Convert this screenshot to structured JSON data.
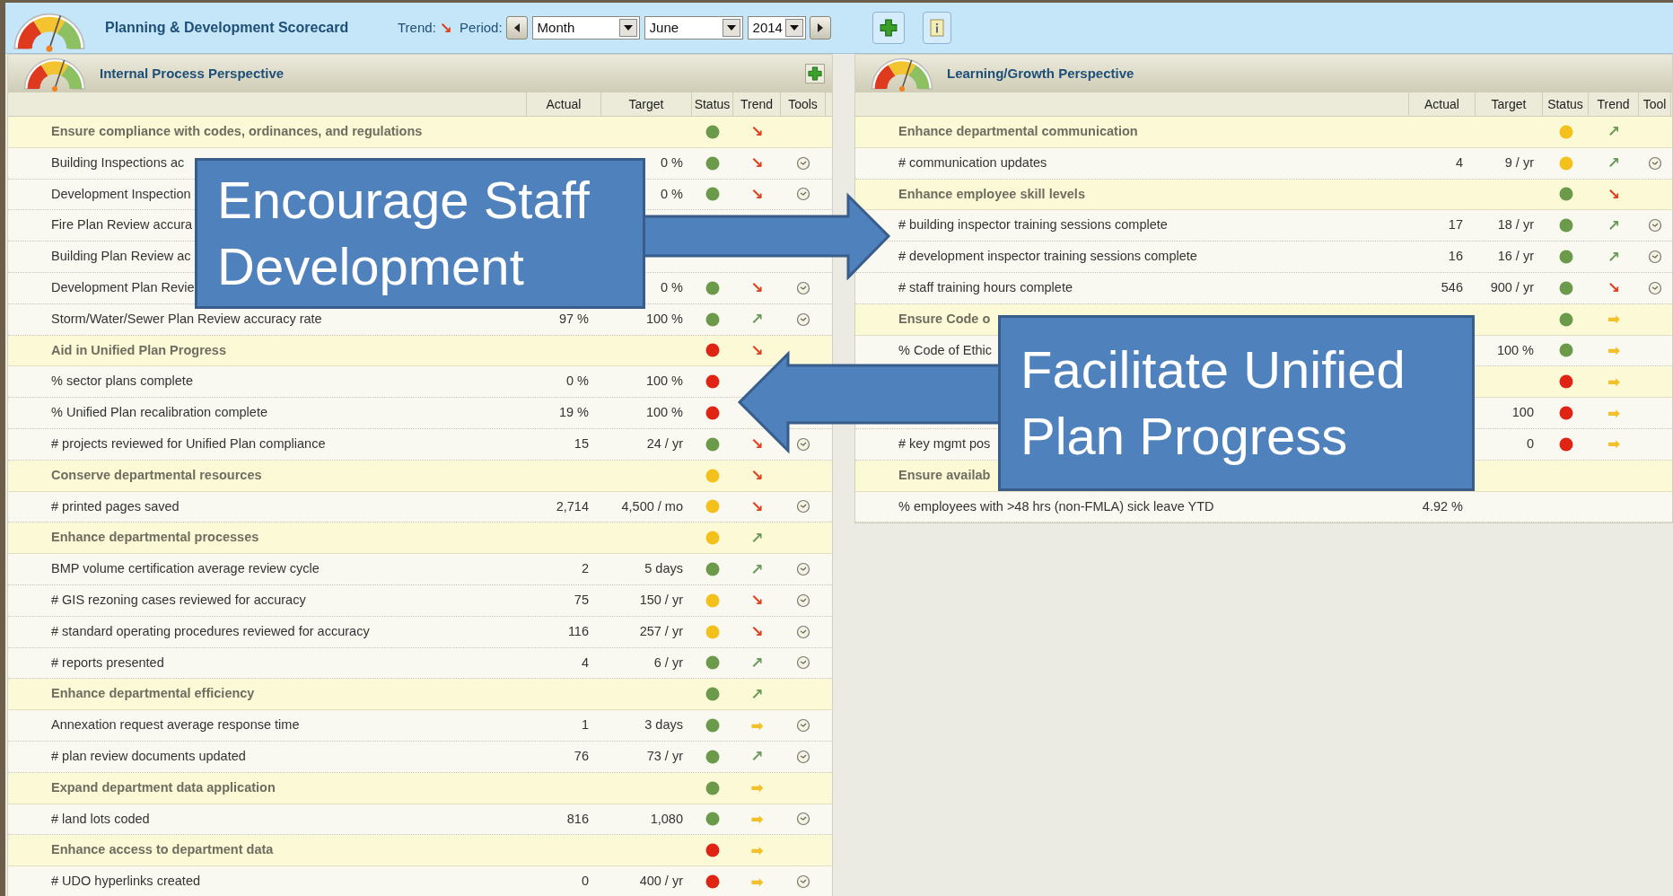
{
  "app": {
    "title": "Planning & Development Scorecard",
    "trend_label": "Trend:",
    "trend": {
      "symbol": "↘",
      "color": "#e0401e"
    },
    "period_label": "Period:",
    "period": "Month",
    "month": "June",
    "year": "2014"
  },
  "left": {
    "title": "Internal Process Perspective",
    "columns": [
      "Actual",
      "Target",
      "Status",
      "Trend",
      "Tools"
    ],
    "rows": [
      {
        "kind": "group",
        "label": "Ensure compliance with codes, ordinances, and regulations",
        "status": {
          "color": "#6a9a4a"
        },
        "trend": {
          "symbol": "↘",
          "color": "#e0401e"
        }
      },
      {
        "kind": "metric",
        "label": "Building Inspections ac",
        "target": "0 %",
        "status": {
          "color": "#6a9a4a"
        },
        "trend": {
          "symbol": "↘",
          "color": "#e0401e"
        },
        "tools": true
      },
      {
        "kind": "metric",
        "label": "Development Inspection",
        "target": "0 %",
        "status": {
          "color": "#6a9a4a"
        },
        "trend": {
          "symbol": "↘",
          "color": "#e0401e"
        },
        "tools": true
      },
      {
        "kind": "metric",
        "label": "Fire Plan Review accura"
      },
      {
        "kind": "metric",
        "label": "Building Plan Review ac"
      },
      {
        "kind": "metric",
        "label": "Development Plan Revie",
        "target": "0 %",
        "status": {
          "color": "#6a9a4a"
        },
        "trend": {
          "symbol": "↘",
          "color": "#e0401e"
        },
        "tools": true
      },
      {
        "kind": "metric",
        "label": "Storm/Water/Sewer Plan Review accuracy rate",
        "actual": "97 %",
        "target": "100 %",
        "status": {
          "color": "#6a9a4a"
        },
        "trend": {
          "symbol": "↗",
          "color": "#6a9a58"
        },
        "tools": true
      },
      {
        "kind": "group",
        "label": "Aid in Unified Plan Progress",
        "status": {
          "color": "#e02414"
        },
        "trend": {
          "symbol": "↘",
          "color": "#e0401e"
        }
      },
      {
        "kind": "metric",
        "label": "% sector plans complete",
        "actual": "0 %",
        "target": "100 %",
        "status": {
          "color": "#e02414"
        }
      },
      {
        "kind": "metric",
        "label": "% Unified Plan recalibration complete",
        "actual": "19 %",
        "target": "100 %",
        "status": {
          "color": "#e02414"
        }
      },
      {
        "kind": "metric",
        "label": "# projects reviewed for Unified Plan compliance",
        "actual": "15",
        "target": "24 / yr",
        "status": {
          "color": "#6a9a4a"
        },
        "trend": {
          "symbol": "↘",
          "color": "#e0401e"
        },
        "tools": true
      },
      {
        "kind": "group",
        "label": "Conserve departmental resources",
        "status": {
          "color": "#f4c01c"
        },
        "trend": {
          "symbol": "↘",
          "color": "#e0401e"
        }
      },
      {
        "kind": "metric",
        "label": "# printed pages saved",
        "actual": "2,714",
        "target": "4,500 / mo",
        "status": {
          "color": "#f4c01c"
        },
        "trend": {
          "symbol": "↘",
          "color": "#e0401e"
        },
        "tools": true
      },
      {
        "kind": "group",
        "label": "Enhance departmental processes",
        "status": {
          "color": "#f4c01c"
        },
        "trend": {
          "symbol": "↗",
          "color": "#6a9a58"
        }
      },
      {
        "kind": "metric",
        "label": "BMP volume certification average review cycle",
        "actual": "2",
        "target": "5 days",
        "status": {
          "color": "#6a9a4a"
        },
        "trend": {
          "symbol": "↗",
          "color": "#6a9a58"
        },
        "tools": true
      },
      {
        "kind": "metric",
        "label": "# GIS rezoning cases reviewed for accuracy",
        "actual": "75",
        "target": "150 / yr",
        "status": {
          "color": "#f4c01c"
        },
        "trend": {
          "symbol": "↘",
          "color": "#e0401e"
        },
        "tools": true
      },
      {
        "kind": "metric",
        "label": "# standard operating procedures reviewed for accuracy",
        "actual": "116",
        "target": "257 / yr",
        "status": {
          "color": "#f4c01c"
        },
        "trend": {
          "symbol": "↘",
          "color": "#e0401e"
        },
        "tools": true
      },
      {
        "kind": "metric",
        "label": "# reports presented",
        "actual": "4",
        "target": "6 / yr",
        "status": {
          "color": "#6a9a4a"
        },
        "trend": {
          "symbol": "↗",
          "color": "#6a9a58"
        },
        "tools": true
      },
      {
        "kind": "group",
        "label": "Enhance departmental efficiency",
        "status": {
          "color": "#6a9a4a"
        },
        "trend": {
          "symbol": "↗",
          "color": "#6a9a58"
        }
      },
      {
        "kind": "metric",
        "label": "Annexation request average response time",
        "actual": "1",
        "target": "3 days",
        "status": {
          "color": "#6a9a4a"
        },
        "trend": {
          "symbol": "➡",
          "color": "#f2c02a"
        },
        "tools": true
      },
      {
        "kind": "metric",
        "label": "# plan review documents updated",
        "actual": "76",
        "target": "73 / yr",
        "status": {
          "color": "#6a9a4a"
        },
        "trend": {
          "symbol": "↗",
          "color": "#6a9a58"
        },
        "tools": true
      },
      {
        "kind": "group",
        "label": "Expand department data application",
        "status": {
          "color": "#6a9a4a"
        },
        "trend": {
          "symbol": "➡",
          "color": "#f2c02a"
        }
      },
      {
        "kind": "metric",
        "label": "# land lots coded",
        "actual": "816",
        "target": "1,080",
        "status": {
          "color": "#6a9a4a"
        },
        "trend": {
          "symbol": "➡",
          "color": "#f2c02a"
        },
        "tools": true
      },
      {
        "kind": "group",
        "label": "Enhance access to department data",
        "status": {
          "color": "#e02414"
        },
        "trend": {
          "symbol": "➡",
          "color": "#f2c02a"
        }
      },
      {
        "kind": "metric",
        "label": "# UDO hyperlinks created",
        "actual": "0",
        "target": "400 / yr",
        "status": {
          "color": "#e02414"
        },
        "trend": {
          "symbol": "➡",
          "color": "#f2c02a"
        },
        "tools": true
      }
    ]
  },
  "right": {
    "title": "Learning/Growth Perspective",
    "columns": [
      "Actual",
      "Target",
      "Status",
      "Trend",
      "Tool"
    ],
    "rows": [
      {
        "kind": "group",
        "label": "Enhance departmental communication",
        "status": {
          "color": "#f4c01c"
        },
        "trend": {
          "symbol": "↗",
          "color": "#6a9a58"
        }
      },
      {
        "kind": "metric",
        "label": "# communication updates",
        "actual": "4",
        "target": "9 / yr",
        "status": {
          "color": "#f4c01c"
        },
        "trend": {
          "symbol": "↗",
          "color": "#6a9a58"
        },
        "tools": true
      },
      {
        "kind": "group",
        "label": "Enhance employee skill levels",
        "status": {
          "color": "#6a9a4a"
        },
        "trend": {
          "symbol": "↘",
          "color": "#e0401e"
        }
      },
      {
        "kind": "metric",
        "label": "# building inspector training sessions complete",
        "actual": "17",
        "target": "18 / yr",
        "status": {
          "color": "#6a9a4a"
        },
        "trend": {
          "symbol": "↗",
          "color": "#6a9a58"
        },
        "tools": true
      },
      {
        "kind": "metric",
        "label": "# development inspector training sessions complete",
        "actual": "16",
        "target": "16 / yr",
        "status": {
          "color": "#6a9a4a"
        },
        "trend": {
          "symbol": "↗",
          "color": "#6a9a58"
        },
        "tools": true
      },
      {
        "kind": "metric",
        "label": "# staff training hours complete",
        "actual": "546",
        "target": "900 / yr",
        "status": {
          "color": "#6a9a4a"
        },
        "trend": {
          "symbol": "↘",
          "color": "#e0401e"
        },
        "tools": true
      },
      {
        "kind": "group",
        "label": "Ensure Code o",
        "status": {
          "color": "#6a9a4a"
        },
        "trend": {
          "symbol": "➡",
          "color": "#f2c02a"
        }
      },
      {
        "kind": "metric",
        "label": "% Code of Ethic",
        "target": "100 %",
        "status": {
          "color": "#6a9a4a"
        },
        "trend": {
          "symbol": "➡",
          "color": "#f2c02a"
        }
      },
      {
        "kind": "group",
        "status": {
          "color": "#e02414"
        },
        "trend": {
          "symbol": "➡",
          "color": "#f2c02a"
        }
      },
      {
        "kind": "metric",
        "target": "100",
        "status": {
          "color": "#e02414"
        },
        "trend": {
          "symbol": "➡",
          "color": "#f2c02a"
        }
      },
      {
        "kind": "metric",
        "label": "# key mgmt pos",
        "target": "0",
        "status": {
          "color": "#e02414"
        },
        "trend": {
          "symbol": "➡",
          "color": "#f2c02a"
        }
      },
      {
        "kind": "group",
        "label": "Ensure availab"
      },
      {
        "kind": "metric",
        "label": "% employees with >48 hrs (non-FMLA) sick leave YTD",
        "actual": "4.92 %"
      }
    ]
  },
  "callouts": [
    "Encourage Staff Development",
    "Facilitate Unified Plan Progress"
  ]
}
